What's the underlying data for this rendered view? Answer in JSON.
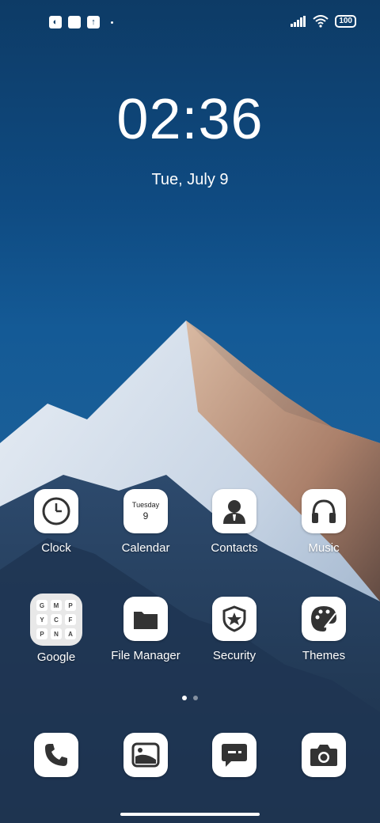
{
  "status": {
    "battery": "100"
  },
  "lockscreen": {
    "time": "02:36",
    "date": "Tue, July 9"
  },
  "apps_row1": [
    {
      "label": "Clock",
      "icon": "clock-icon"
    },
    {
      "label": "Calendar",
      "icon": "calendar-icon",
      "weekday": "Tuesday",
      "day": "9"
    },
    {
      "label": "Contacts",
      "icon": "contacts-icon"
    },
    {
      "label": "Music",
      "icon": "headphones-icon"
    }
  ],
  "apps_row2": [
    {
      "label": "Google",
      "icon": "google-folder-icon"
    },
    {
      "label": "File Manager",
      "icon": "folder-icon"
    },
    {
      "label": "Security",
      "icon": "shield-star-icon"
    },
    {
      "label": "Themes",
      "icon": "palette-icon"
    }
  ],
  "folder_minis": [
    "G",
    "M",
    "P",
    "Y",
    "C",
    "F",
    "P",
    "N",
    "A"
  ],
  "dock": [
    {
      "icon": "phone-icon"
    },
    {
      "icon": "gallery-icon"
    },
    {
      "icon": "messages-icon"
    },
    {
      "icon": "camera-icon"
    }
  ],
  "pager": {
    "pages": 2,
    "active": 1
  }
}
